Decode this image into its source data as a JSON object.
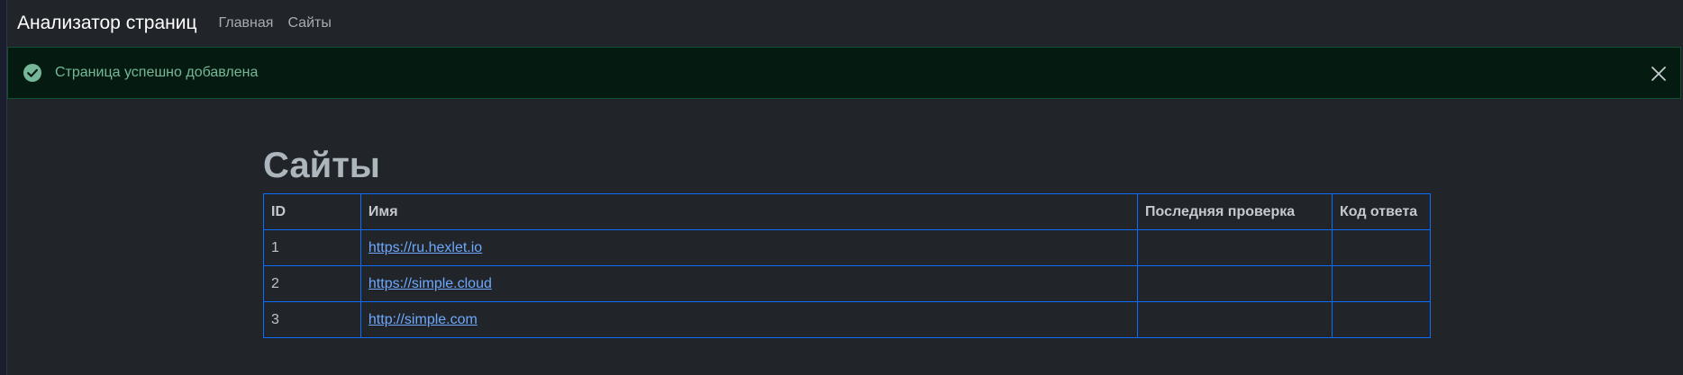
{
  "navbar": {
    "brand": "Анализатор страниц",
    "links": [
      {
        "label": "Главная"
      },
      {
        "label": "Сайты"
      }
    ]
  },
  "alert": {
    "message": "Страница успешно добавлена",
    "icon": "check-circle-icon",
    "close_icon": "close-icon",
    "colors": {
      "background": "#051b11",
      "border": "#0f5132",
      "text": "#75b798"
    }
  },
  "page": {
    "title": "Сайты"
  },
  "table": {
    "headers": [
      "ID",
      "Имя",
      "Последняя проверка",
      "Код ответа"
    ],
    "rows": [
      {
        "id": "1",
        "name": "https://ru.hexlet.io",
        "last_check": "",
        "status_code": ""
      },
      {
        "id": "2",
        "name": "https://simple.cloud",
        "last_check": "",
        "status_code": ""
      },
      {
        "id": "3",
        "name": "http://simple.com",
        "last_check": "",
        "status_code": ""
      }
    ],
    "colors": {
      "border": "#0d6efd",
      "link": "#6ea8fe"
    }
  }
}
